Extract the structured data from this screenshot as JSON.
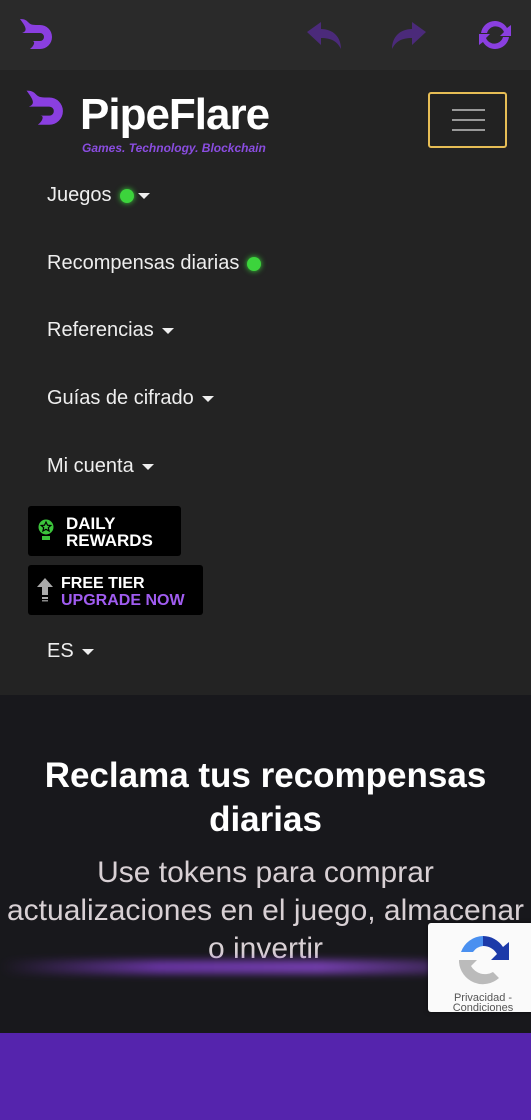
{
  "browser": {
    "icons": [
      "pipeflare-logo-icon",
      "back-icon",
      "forward-icon",
      "refresh-icon"
    ]
  },
  "header": {
    "brand": "PipeFlare",
    "tagline": "Games. Technology. Blockchain",
    "accent": "#8a4de0"
  },
  "menu": {
    "items": [
      {
        "label": "Juegos",
        "dot": true,
        "caret": true
      },
      {
        "label": "Recompensas diarias",
        "dot": true,
        "caret": false
      },
      {
        "label": "Referencias",
        "caret": true
      },
      {
        "label": "Guías de cifrado",
        "caret": true
      },
      {
        "label": "Mi cuenta",
        "caret": true
      }
    ],
    "daily_rewards": {
      "line1": "DAILY",
      "line2": "REWARDS"
    },
    "free_tier": {
      "line1": "FREE TIER",
      "line2": "UPGRADE NOW"
    },
    "language": "ES"
  },
  "hero": {
    "title": "Reclama tus recompensas diarias",
    "subtitle": "Use tokens para comprar actualizaciones en el juego, almacenar o invertir"
  },
  "recaptcha": {
    "privacy": "Privacidad -",
    "terms": "Condiciones"
  }
}
